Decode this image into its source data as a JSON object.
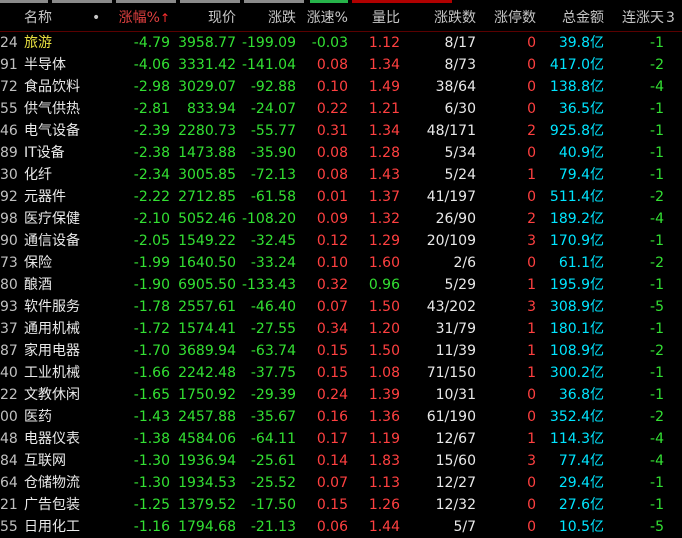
{
  "headers": {
    "code": "",
    "name": "名称",
    "dot": "•",
    "change_pct": "涨幅%",
    "change_arrow": "↑",
    "price": "现价",
    "change": "涨跌",
    "speed": "涨速%",
    "volume_ratio": "量比",
    "up_down": "涨跌数",
    "limit_up": "涨停数",
    "amount": "总金额",
    "streak": "连涨天",
    "extra": "3"
  },
  "rows": [
    {
      "code": "24",
      "name": "旅游",
      "change_pct": "-4.79",
      "price": "3958.77",
      "change": "-199.09",
      "speed": "-0.03",
      "volume_ratio": "1.12",
      "up_down": "8/17",
      "limit_up": "0",
      "amount": "39.8",
      "unit": "亿",
      "streak": "-1"
    },
    {
      "code": "91",
      "name": "半导体",
      "change_pct": "-4.06",
      "price": "3331.42",
      "change": "-141.04",
      "speed": "0.08",
      "volume_ratio": "1.34",
      "up_down": "8/73",
      "limit_up": "0",
      "amount": "417.0",
      "unit": "亿",
      "streak": "-2"
    },
    {
      "code": "72",
      "name": "食品饮料",
      "change_pct": "-2.98",
      "price": "3029.07",
      "change": "-92.88",
      "speed": "0.10",
      "volume_ratio": "1.49",
      "up_down": "38/64",
      "limit_up": "0",
      "amount": "138.8",
      "unit": "亿",
      "streak": "-4"
    },
    {
      "code": "55",
      "name": "供气供热",
      "change_pct": "-2.81",
      "price": "833.94",
      "change": "-24.07",
      "speed": "0.22",
      "volume_ratio": "1.21",
      "up_down": "6/30",
      "limit_up": "0",
      "amount": "36.5",
      "unit": "亿",
      "streak": "-1"
    },
    {
      "code": "46",
      "name": "电气设备",
      "change_pct": "-2.39",
      "price": "2280.73",
      "change": "-55.77",
      "speed": "0.31",
      "volume_ratio": "1.34",
      "up_down": "48/171",
      "limit_up": "2",
      "amount": "925.8",
      "unit": "亿",
      "streak": "-1"
    },
    {
      "code": "89",
      "name": "IT设备",
      "change_pct": "-2.38",
      "price": "1473.88",
      "change": "-35.90",
      "speed": "0.08",
      "volume_ratio": "1.28",
      "up_down": "5/34",
      "limit_up": "0",
      "amount": "40.9",
      "unit": "亿",
      "streak": "-1"
    },
    {
      "code": "30",
      "name": "化纤",
      "change_pct": "-2.34",
      "price": "3005.85",
      "change": "-72.13",
      "speed": "0.08",
      "volume_ratio": "1.43",
      "up_down": "5/24",
      "limit_up": "1",
      "amount": "79.4",
      "unit": "亿",
      "streak": "-1"
    },
    {
      "code": "92",
      "name": "元器件",
      "change_pct": "-2.22",
      "price": "2712.85",
      "change": "-61.58",
      "speed": "0.01",
      "volume_ratio": "1.37",
      "up_down": "41/197",
      "limit_up": "0",
      "amount": "511.4",
      "unit": "亿",
      "streak": "-2"
    },
    {
      "code": "98",
      "name": "医疗保健",
      "change_pct": "-2.10",
      "price": "5052.46",
      "change": "-108.20",
      "speed": "0.09",
      "volume_ratio": "1.32",
      "up_down": "26/90",
      "limit_up": "2",
      "amount": "189.2",
      "unit": "亿",
      "streak": "-4"
    },
    {
      "code": "90",
      "name": "通信设备",
      "change_pct": "-2.05",
      "price": "1549.22",
      "change": "-32.45",
      "speed": "0.12",
      "volume_ratio": "1.29",
      "up_down": "20/109",
      "limit_up": "3",
      "amount": "170.9",
      "unit": "亿",
      "streak": "-1"
    },
    {
      "code": "73",
      "name": "保险",
      "change_pct": "-1.99",
      "price": "1640.50",
      "change": "-33.24",
      "speed": "0.10",
      "volume_ratio": "1.60",
      "up_down": "2/6",
      "limit_up": "0",
      "amount": "61.1",
      "unit": "亿",
      "streak": "-2"
    },
    {
      "code": "80",
      "name": "酿酒",
      "change_pct": "-1.90",
      "price": "6905.50",
      "change": "-133.43",
      "speed": "0.32",
      "volume_ratio": "0.96",
      "up_down": "5/29",
      "limit_up": "1",
      "amount": "195.9",
      "unit": "亿",
      "streak": "-1"
    },
    {
      "code": "93",
      "name": "软件服务",
      "change_pct": "-1.78",
      "price": "2557.61",
      "change": "-46.40",
      "speed": "0.07",
      "volume_ratio": "1.50",
      "up_down": "43/202",
      "limit_up": "3",
      "amount": "308.9",
      "unit": "亿",
      "streak": "-5"
    },
    {
      "code": "37",
      "name": "通用机械",
      "change_pct": "-1.72",
      "price": "1574.41",
      "change": "-27.55",
      "speed": "0.34",
      "volume_ratio": "1.20",
      "up_down": "31/79",
      "limit_up": "1",
      "amount": "180.1",
      "unit": "亿",
      "streak": "-1"
    },
    {
      "code": "87",
      "name": "家用电器",
      "change_pct": "-1.70",
      "price": "3689.94",
      "change": "-63.74",
      "speed": "0.15",
      "volume_ratio": "1.50",
      "up_down": "11/39",
      "limit_up": "1",
      "amount": "108.9",
      "unit": "亿",
      "streak": "-2"
    },
    {
      "code": "40",
      "name": "工业机械",
      "change_pct": "-1.66",
      "price": "2242.48",
      "change": "-37.75",
      "speed": "0.15",
      "volume_ratio": "1.08",
      "up_down": "71/150",
      "limit_up": "1",
      "amount": "300.2",
      "unit": "亿",
      "streak": "-1"
    },
    {
      "code": "22",
      "name": "文教休闲",
      "change_pct": "-1.65",
      "price": "1750.92",
      "change": "-29.39",
      "speed": "0.24",
      "volume_ratio": "1.39",
      "up_down": "10/31",
      "limit_up": "0",
      "amount": "36.8",
      "unit": "亿",
      "streak": "-1"
    },
    {
      "code": "00",
      "name": "医药",
      "change_pct": "-1.43",
      "price": "2457.88",
      "change": "-35.67",
      "speed": "0.16",
      "volume_ratio": "1.36",
      "up_down": "61/190",
      "limit_up": "0",
      "amount": "352.4",
      "unit": "亿",
      "streak": "-2"
    },
    {
      "code": "48",
      "name": "电器仪表",
      "change_pct": "-1.38",
      "price": "4584.06",
      "change": "-64.11",
      "speed": "0.17",
      "volume_ratio": "1.19",
      "up_down": "12/67",
      "limit_up": "1",
      "amount": "114.3",
      "unit": "亿",
      "streak": "-4"
    },
    {
      "code": "84",
      "name": "互联网",
      "change_pct": "-1.30",
      "price": "1936.94",
      "change": "-25.61",
      "speed": "0.14",
      "volume_ratio": "1.83",
      "up_down": "15/60",
      "limit_up": "3",
      "amount": "77.4",
      "unit": "亿",
      "streak": "-4"
    },
    {
      "code": "64",
      "name": "仓储物流",
      "change_pct": "-1.30",
      "price": "1934.53",
      "change": "-25.52",
      "speed": "0.07",
      "volume_ratio": "1.13",
      "up_down": "12/27",
      "limit_up": "0",
      "amount": "29.4",
      "unit": "亿",
      "streak": "-1"
    },
    {
      "code": "21",
      "name": "广告包装",
      "change_pct": "-1.25",
      "price": "1379.52",
      "change": "-17.50",
      "speed": "0.15",
      "volume_ratio": "1.26",
      "up_down": "12/32",
      "limit_up": "0",
      "amount": "27.6",
      "unit": "亿",
      "streak": "-1"
    },
    {
      "code": "55",
      "name": "日用化工",
      "change_pct": "-1.16",
      "price": "1794.68",
      "change": "-21.13",
      "speed": "0.06",
      "volume_ratio": "1.44",
      "up_down": "5/7",
      "limit_up": "0",
      "amount": "10.5",
      "unit": "亿",
      "streak": "-5"
    }
  ],
  "colors": {
    "up": "#ff4040",
    "down": "#33e033",
    "neutral": "#e9e9e9",
    "amount": "#00e5ff",
    "background": "#000000"
  }
}
